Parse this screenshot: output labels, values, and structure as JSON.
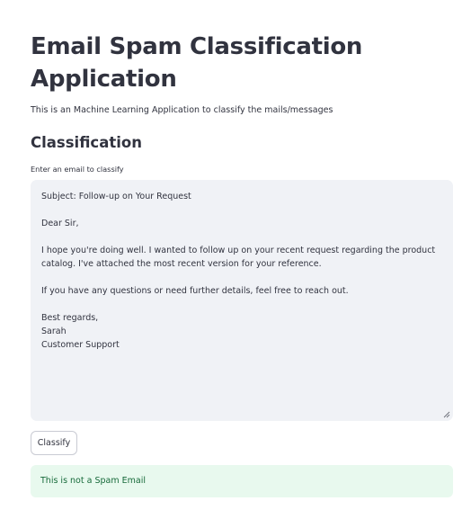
{
  "page": {
    "title": "Email Spam Classification Application",
    "subtitle": "This is an Machine Learning Application to classify the mails/messages",
    "section_heading": "Classification"
  },
  "form": {
    "field_label": "Enter an email to classify",
    "email_value": "Subject: Follow-up on Your Request\n\nDear Sir,\n\nI hope you're doing well. I wanted to follow up on your recent request regarding the product catalog. I've attached the most recent version for your reference.\n\nIf you have any questions or need further details, feel free to reach out.\n\nBest regards,\nSarah\nCustomer Support",
    "submit_label": "Classify"
  },
  "result": {
    "message": "This is not a Spam Email",
    "status": "success"
  },
  "colors": {
    "text": "#31333f",
    "input_background": "#f0f2f6",
    "success_background": "#e8f9ee",
    "success_text": "#176a3a",
    "button_border": "#c9cbd3"
  },
  "icons": {
    "textarea_resize": "resize-grip-icon"
  }
}
